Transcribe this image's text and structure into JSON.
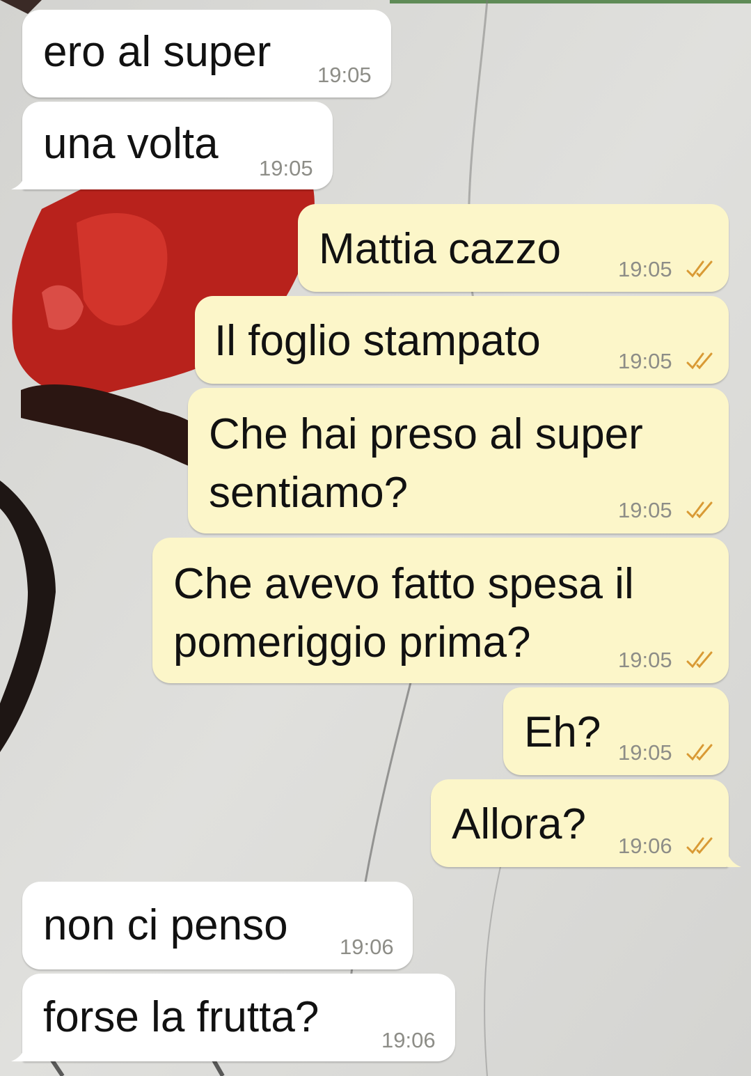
{
  "messages": [
    {
      "direction": "in",
      "text": "ero al super",
      "time": "19:05"
    },
    {
      "direction": "in",
      "text": "una volta",
      "time": "19:05"
    },
    {
      "direction": "out",
      "text": "Mattia cazzo",
      "time": "19:05",
      "status_icon": "double-check-icon"
    },
    {
      "direction": "out",
      "text": "Il foglio stampato",
      "time": "19:05",
      "status_icon": "double-check-icon"
    },
    {
      "direction": "out",
      "lines": [
        "Che hai preso al super",
        "sentiamo?"
      ],
      "time": "19:05",
      "status_icon": "double-check-icon"
    },
    {
      "direction": "out",
      "lines": [
        "Che avevo fatto spesa il",
        "pomeriggio prima?"
      ],
      "time": "19:05",
      "status_icon": "double-check-icon"
    },
    {
      "direction": "out",
      "text": "Eh?",
      "time": "19:05",
      "status_icon": "double-check-icon"
    },
    {
      "direction": "out",
      "text": "Allora?",
      "time": "19:06",
      "status_icon": "double-check-icon"
    },
    {
      "direction": "in",
      "text": "non ci penso",
      "time": "19:06"
    },
    {
      "direction": "in",
      "text": "forse la frutta?",
      "time": "19:06"
    }
  ],
  "colors": {
    "incoming_bubble": "#ffffff",
    "outgoing_bubble": "#fcf6c9",
    "read_check": "#d99a35",
    "timestamp": "#8d8d87",
    "wallpaper_red": "#c0201b"
  }
}
